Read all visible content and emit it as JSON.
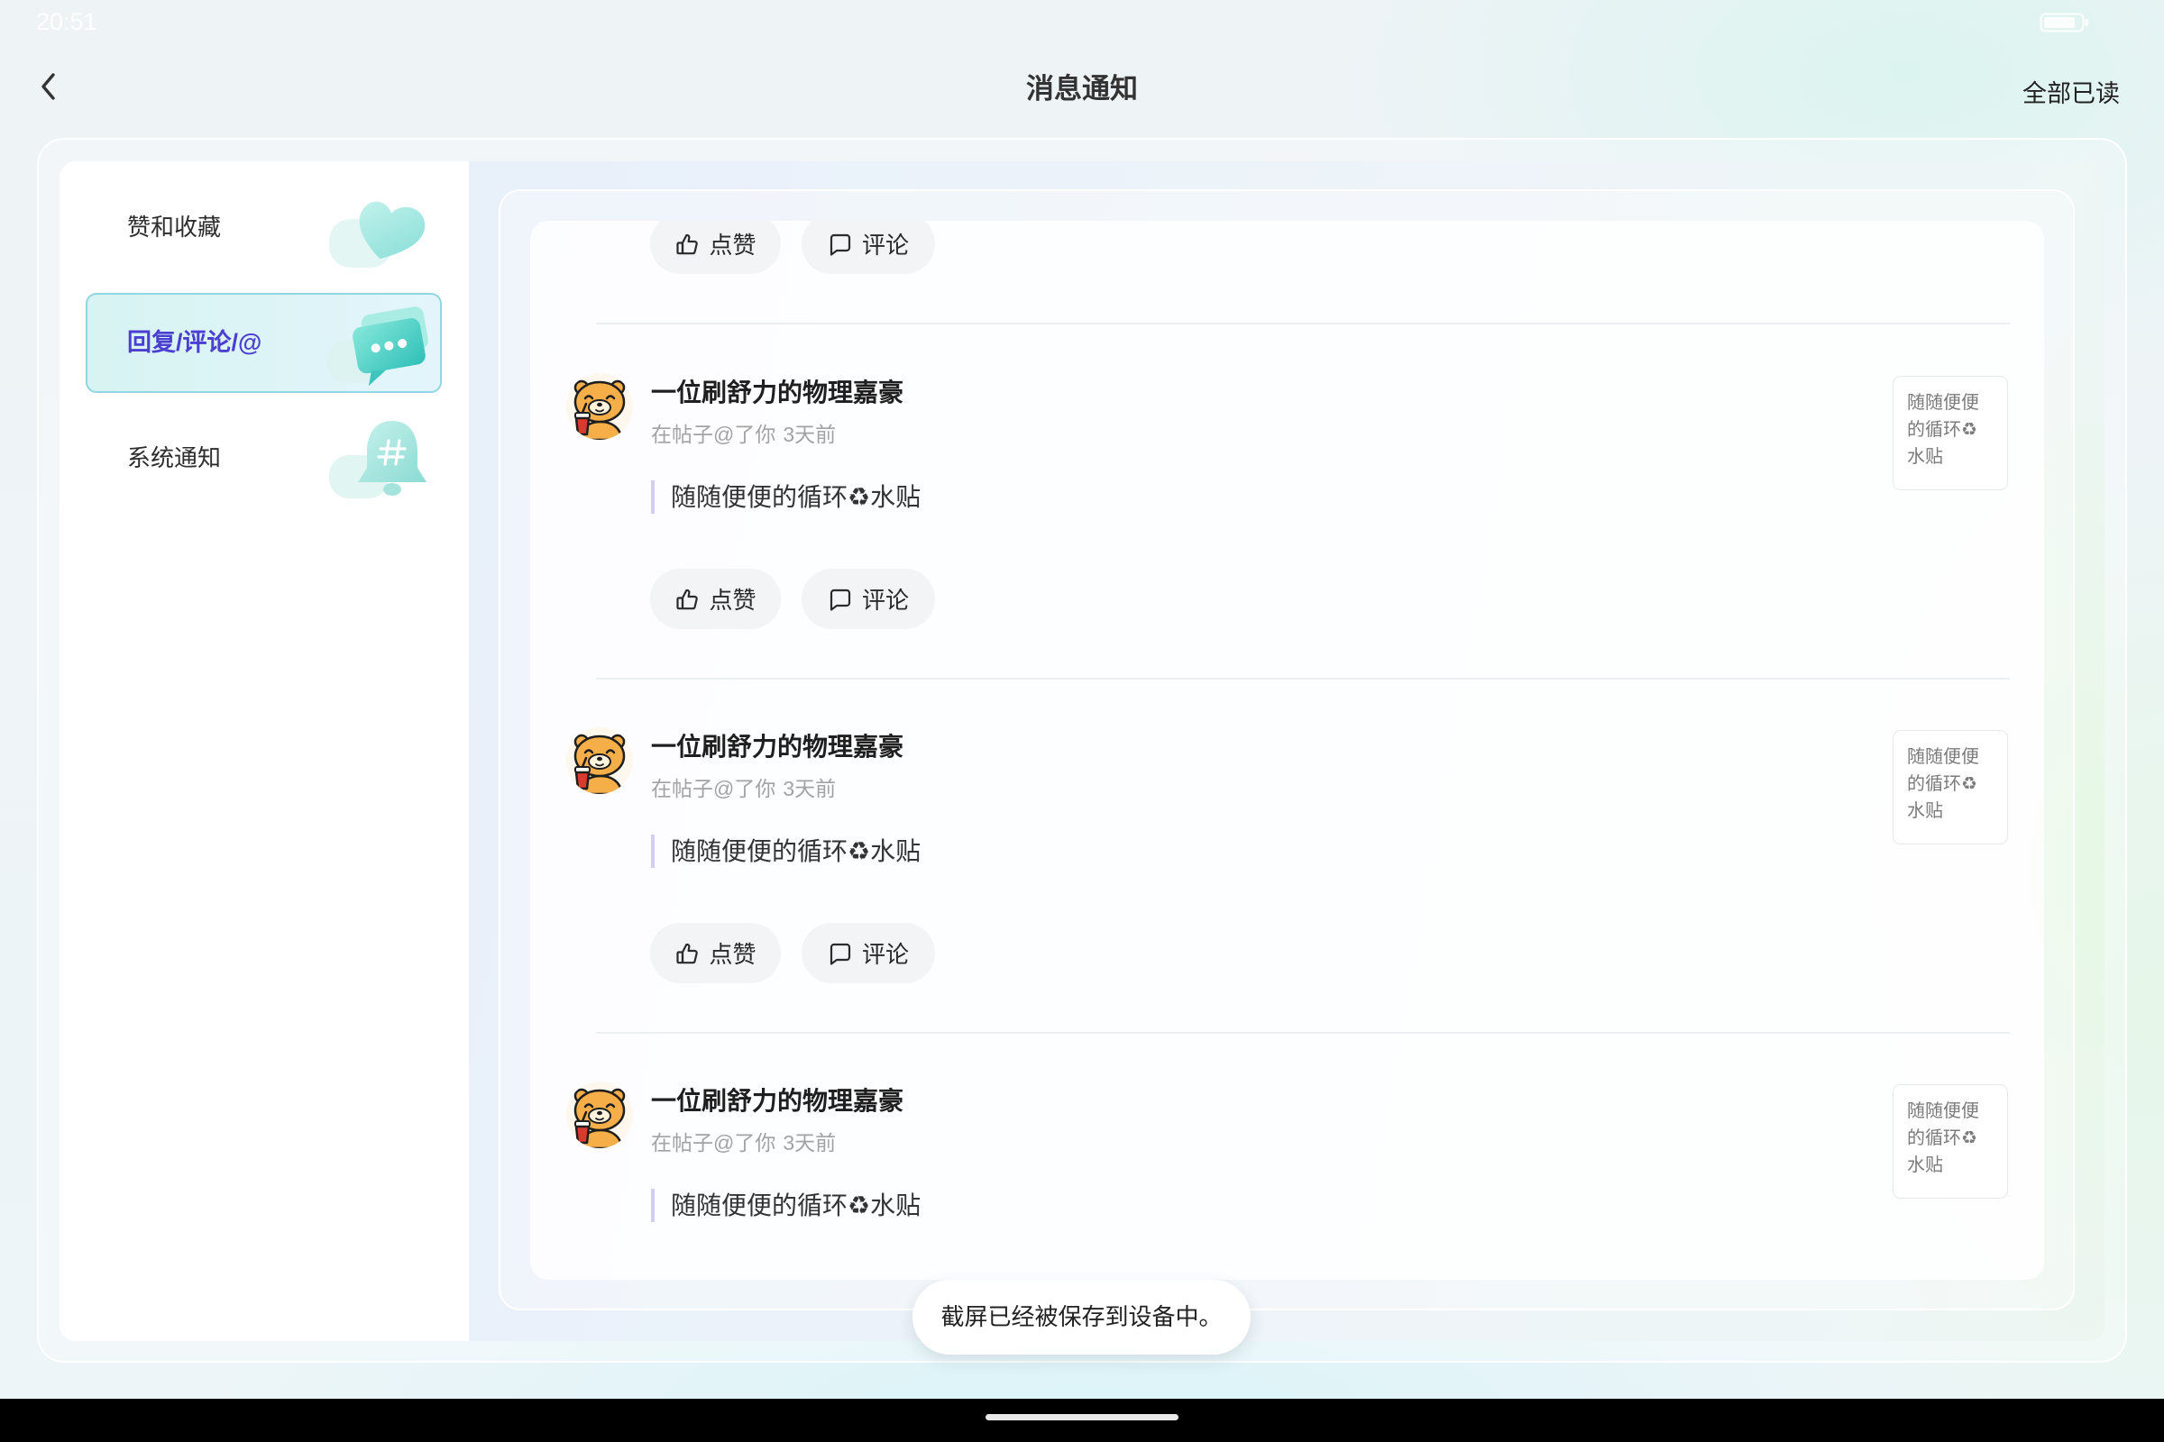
{
  "status_bar": {
    "time": "20:51",
    "battery_icon": "battery-icon"
  },
  "header": {
    "back_icon": "chevron-left-icon",
    "title": "消息通知",
    "mark_all_read": "全部已读"
  },
  "sidebar": {
    "items": [
      {
        "label": "赞和收藏",
        "icon": "heart-icon",
        "selected": false
      },
      {
        "label": "回复/评论/@",
        "icon": "chat-bubbles-icon",
        "selected": true
      },
      {
        "label": "系统通知",
        "icon": "bell-icon",
        "selected": false
      }
    ]
  },
  "notifications": {
    "actions": {
      "like_label": "点赞",
      "like_icon": "thumbs-up-icon",
      "comment_label": "评论",
      "comment_icon": "comment-icon"
    },
    "items": [
      {
        "user_name": "一位刷舒力的物理嘉豪",
        "action_text": "在帖子@了你",
        "time": "3天前",
        "quote": "随随便便的循环♻水贴",
        "thumbnail_text": "随随便便的循环♻水贴"
      },
      {
        "user_name": "一位刷舒力的物理嘉豪",
        "action_text": "在帖子@了你",
        "time": "3天前",
        "quote": "随随便便的循环♻水贴",
        "thumbnail_text": "随随便便的循环♻水贴"
      },
      {
        "user_name": "一位刷舒力的物理嘉豪",
        "action_text": "在帖子@了你",
        "time": "3天前",
        "quote": "随随便便的循环♻水贴",
        "thumbnail_text": "随随便便的循环♻水贴"
      }
    ]
  },
  "toast": {
    "message": "截屏已经被保存到设备中。"
  },
  "theme": {
    "accent": "#4a3fd0",
    "selected_bg": "#d7f3f2",
    "selected_border": "#8fd7e2",
    "quote_bar": "#d3cdf4",
    "icon_teal": "#3cc6bd",
    "nav_bar": "#000000"
  }
}
